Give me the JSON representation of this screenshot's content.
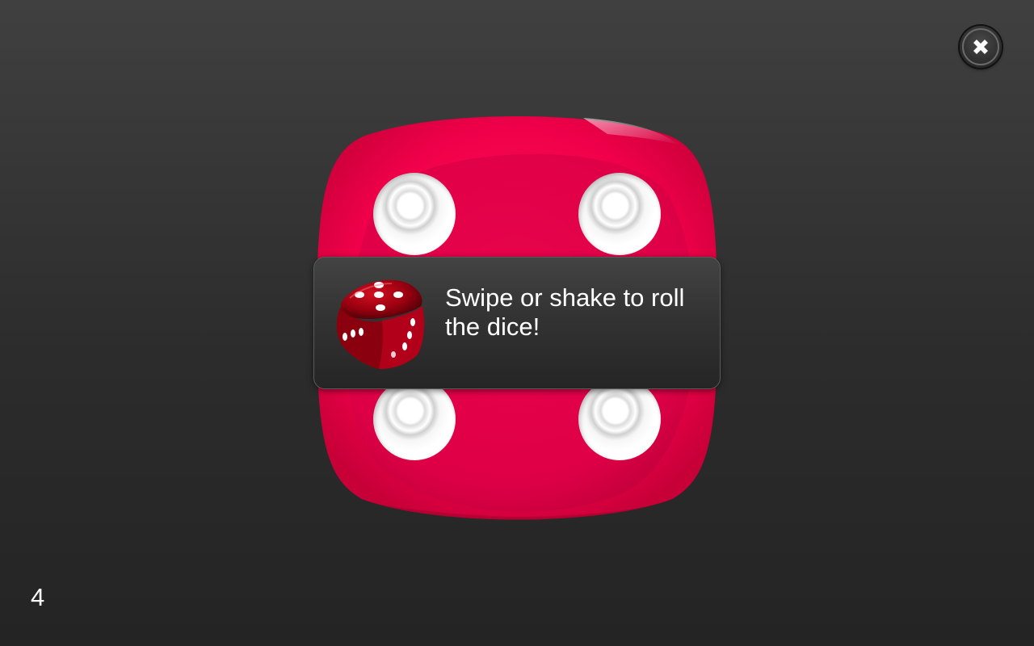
{
  "close_button": {
    "icon": "close-icon"
  },
  "die": {
    "face_value": 4,
    "color": "#e8003f",
    "pip_color": "#ffffff"
  },
  "toast": {
    "icon": "red-die-icon",
    "message": "Swipe or shake to roll the dice!"
  },
  "status": {
    "roll_value": "4"
  },
  "colors": {
    "background": "#333333",
    "die_red": "#e8003f",
    "toast_bg": "#333333"
  }
}
